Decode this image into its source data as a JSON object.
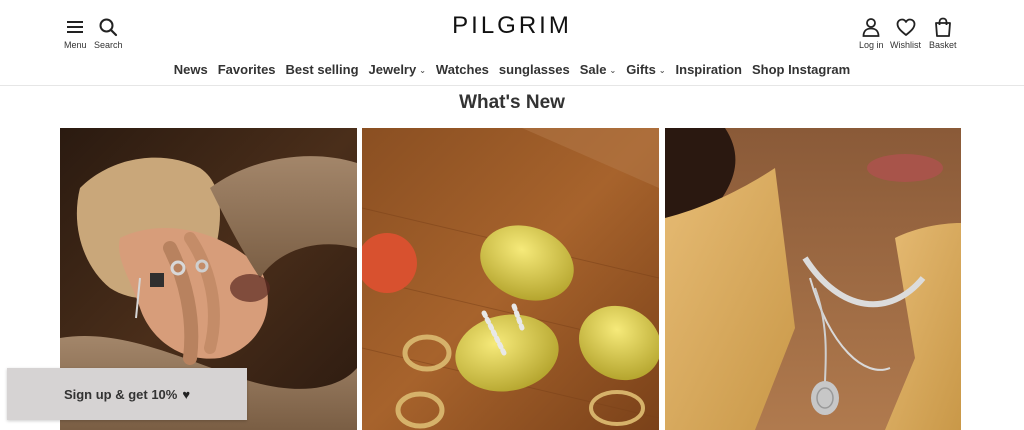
{
  "header": {
    "logo": "PILGRIM",
    "menu_label": "Menu",
    "search_label": "Search",
    "login_label": "Log in",
    "wishlist_label": "Wishlist",
    "basket_label": "Basket"
  },
  "nav": {
    "items": [
      {
        "label": "News"
      },
      {
        "label": "Favorites"
      },
      {
        "label": "Best selling"
      },
      {
        "label": "Jewelry"
      },
      {
        "label": "Watches"
      },
      {
        "label": "sunglasses"
      },
      {
        "label": "Sale"
      },
      {
        "label": "Gifts"
      },
      {
        "label": "Inspiration"
      },
      {
        "label": "Shop Instagram"
      }
    ]
  },
  "main": {
    "section_title": "What's New"
  },
  "signup": {
    "label": "Sign up & get 10%",
    "icon": "heart-icon"
  },
  "colors": {
    "background": "#ffffff",
    "text": "#333333",
    "signup_bg": "#d6d3d3"
  }
}
